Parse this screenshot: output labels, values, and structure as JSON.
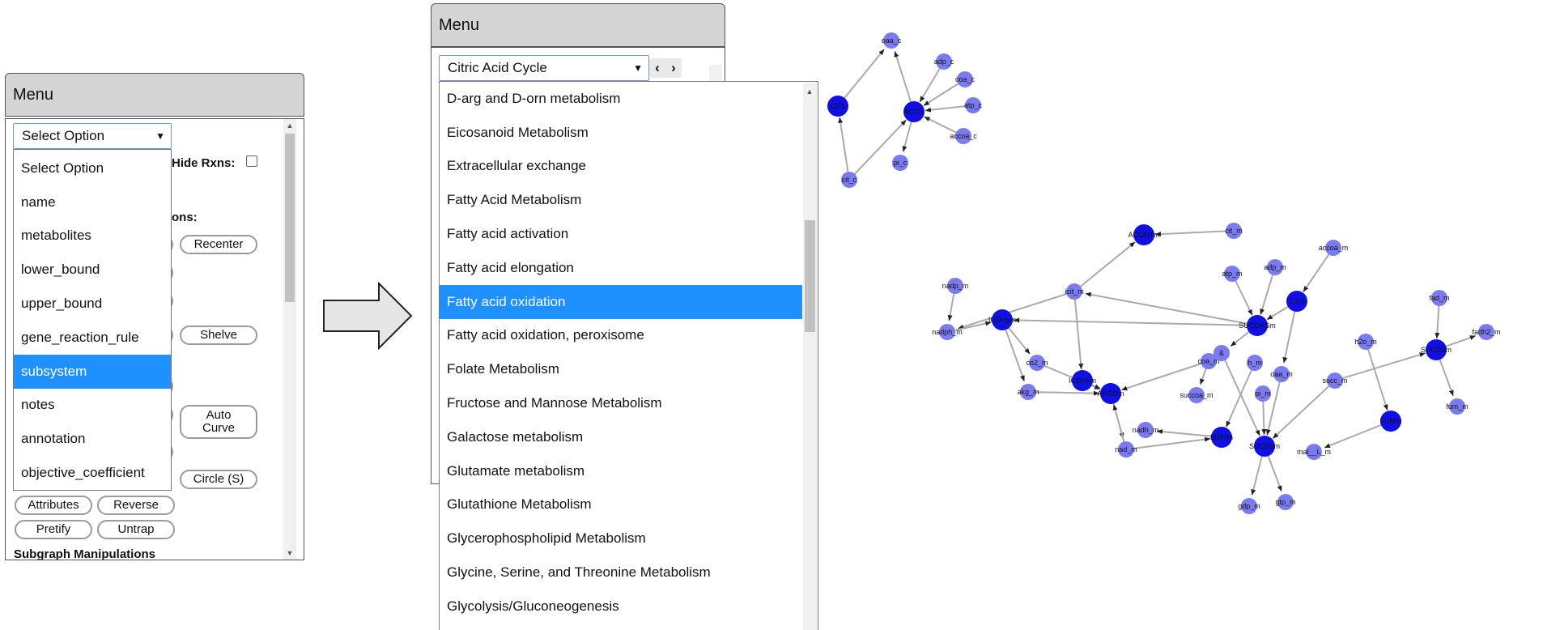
{
  "left_panel": {
    "header": "Menu",
    "select_value": "Select Option",
    "hide_rxns_label": "Hide Rxns:",
    "section_partial": "ons:",
    "buttons": {
      "recenter": "Recenter",
      "shelve": "Shelve",
      "auto_curve": "Auto Curve",
      "circle": "Circle (S)",
      "attributes": "Attributes",
      "reverse": "Reverse",
      "prettify": "Pretify",
      "untrap": "Untrap"
    },
    "subgraph_heading": "Subgraph Manipulations",
    "options": [
      "Select Option",
      "name",
      "metabolites",
      "lower_bound",
      "upper_bound",
      "gene_reaction_rule",
      "subsystem",
      "notes",
      "annotation",
      "objective_coefficient"
    ],
    "selected_option": "subsystem"
  },
  "right_panel": {
    "header": "Menu",
    "select_value": "Citric Acid Cycle",
    "prev_glyph": "‹",
    "next_glyph": "›",
    "options": [
      "D-arg and D-orn metabolism",
      "Eicosanoid Metabolism",
      "Extracellular exchange",
      "Fatty Acid Metabolism",
      "Fatty acid activation",
      "Fatty acid elongation",
      "Fatty acid oxidation",
      "Fatty acid oxidation, peroxisome",
      "Folate Metabolism",
      "Fructose and Mannose Metabolism",
      "Galactose metabolism",
      "Glutamate metabolism",
      "Glutathione Metabolism",
      "Glycerophospholipid Metabolism",
      "Glycine, Serine, and Threonine Metabolism",
      "Glycolysis/Gluconeogenesis"
    ],
    "selected_option": "Fatty acid oxidation"
  },
  "graph": {
    "colors": {
      "reaction": "#1010e6",
      "metabolite": "#7b7bf0",
      "edge": "#aaaaaa"
    },
    "upper_labels": [
      "oaa_c",
      "adp_c",
      "coa_c",
      "atp_c",
      "accoa_c",
      "cit_c",
      "pi_c",
      "CITL",
      "ACITL"
    ],
    "lower_labels": [
      "ACONTm",
      "cit_m",
      "accoa_m",
      "atp_m",
      "adp_m",
      "nadp_m",
      "icit_m",
      "CSm",
      "nadph_m",
      "ICDHym",
      "SUCOASm",
      "fad_m",
      "fadh2_m",
      "co2_m",
      "h2o_m",
      "SUCD1m",
      "coa_m",
      "&",
      "h_m",
      "ICDHxm",
      "akg_m",
      "AKGDm",
      "oaa_m",
      "succoa_m",
      "pi_m",
      "succ_m",
      "FUMm",
      "fum_m",
      "nadh_m",
      "nad_m",
      "MDHm",
      "SUCD1m",
      "mal__L_m",
      "gdp_m",
      "gtp_m"
    ]
  }
}
